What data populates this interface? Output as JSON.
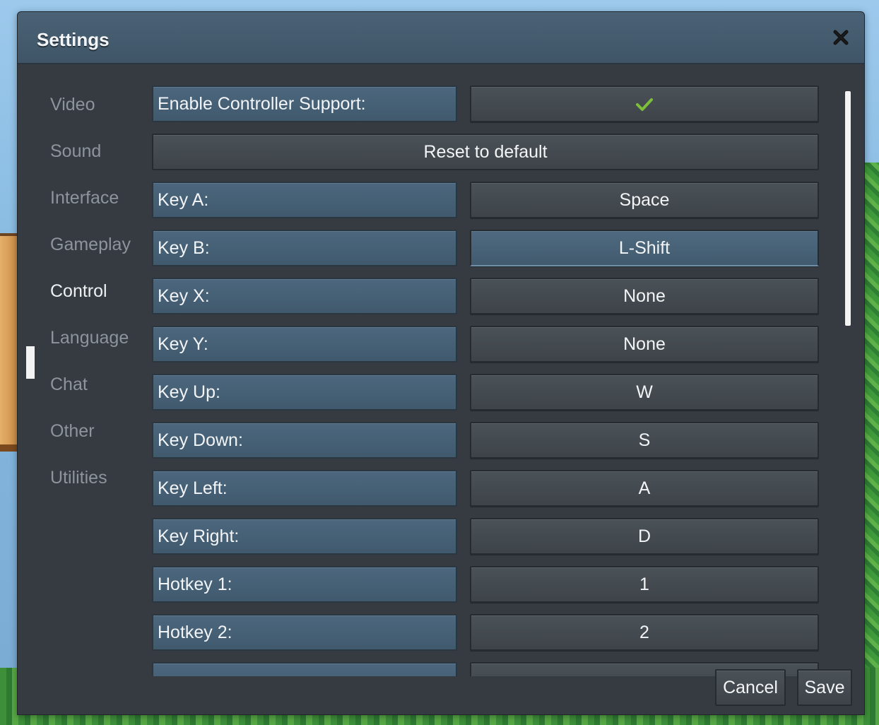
{
  "dialog": {
    "title": "Settings",
    "close_icon": "close-icon"
  },
  "sidebar": {
    "items": [
      {
        "label": "Video"
      },
      {
        "label": "Sound"
      },
      {
        "label": "Interface"
      },
      {
        "label": "Gameplay"
      },
      {
        "label": "Control",
        "active": true
      },
      {
        "label": "Language"
      },
      {
        "label": "Chat"
      },
      {
        "label": "Other"
      },
      {
        "label": "Utilities"
      }
    ]
  },
  "controls": {
    "controller_support": {
      "label": "Enable Controller Support:",
      "checked": true,
      "icon": "checkmark-icon",
      "check_color": "#7cbf3a"
    },
    "reset_label": "Reset to default",
    "bindings": [
      {
        "label": "Key A:",
        "value": "Space"
      },
      {
        "label": "Key B:",
        "value": "L-Shift"
      },
      {
        "label": "Key X:",
        "value": "None"
      },
      {
        "label": "Key Y:",
        "value": "None"
      },
      {
        "label": "Key Up:",
        "value": "W"
      },
      {
        "label": "Key Down:",
        "value": "S"
      },
      {
        "label": "Key Left:",
        "value": "A"
      },
      {
        "label": "Key Right:",
        "value": "D"
      },
      {
        "label": "Hotkey 1:",
        "value": "1"
      },
      {
        "label": "Hotkey 2:",
        "value": "2"
      }
    ]
  },
  "footer": {
    "cancel_label": "Cancel",
    "save_label": "Save"
  },
  "colors": {
    "panel": "#363b41",
    "titlebar": "#455b6e",
    "label_box": "#46607a",
    "button": "#43494f",
    "accent_check": "#7cbf3a"
  }
}
